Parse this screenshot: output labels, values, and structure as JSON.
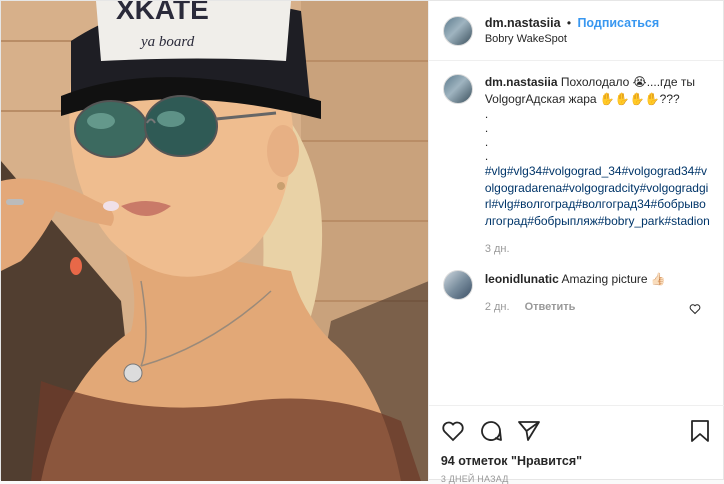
{
  "post": {
    "photo_alt": "Selfie photo",
    "cap_text": "XKATE",
    "cap_subtext": "ya board"
  },
  "header": {
    "username": "dm.nastasiia",
    "separator": "•",
    "follow_label": "Подписаться",
    "location": "Bobry WakeSpot"
  },
  "caption": {
    "username": "dm.nastasiia",
    "text": "Похолодало 😭....где ты VolgogrAдская жара ✋✋✋✋???",
    "dots": [
      ".",
      ".",
      ".",
      "."
    ],
    "hashtags": "#vlg#vlg34#volgograd_34#volgograd34#volgogradarena#volgogradcity#volgogradgirl#vlg#волгоград#волгоград34#бобрыволгоград#бобрыпляж#bobry_park#stadion",
    "age": "3 дн."
  },
  "comments": [
    {
      "username": "leonidlunatic",
      "text": "Amazing picture 👍🏻",
      "age": "2 дн.",
      "reply_label": "Ответить"
    }
  ],
  "actions": {
    "likes_count": "94 отметок",
    "likes_suffix": "\"Нравится\"",
    "date": "3 ДНЕЙ НАЗАД"
  },
  "colors": {
    "link": "#3897f0",
    "hashtag": "#003569",
    "muted": "#999999"
  }
}
